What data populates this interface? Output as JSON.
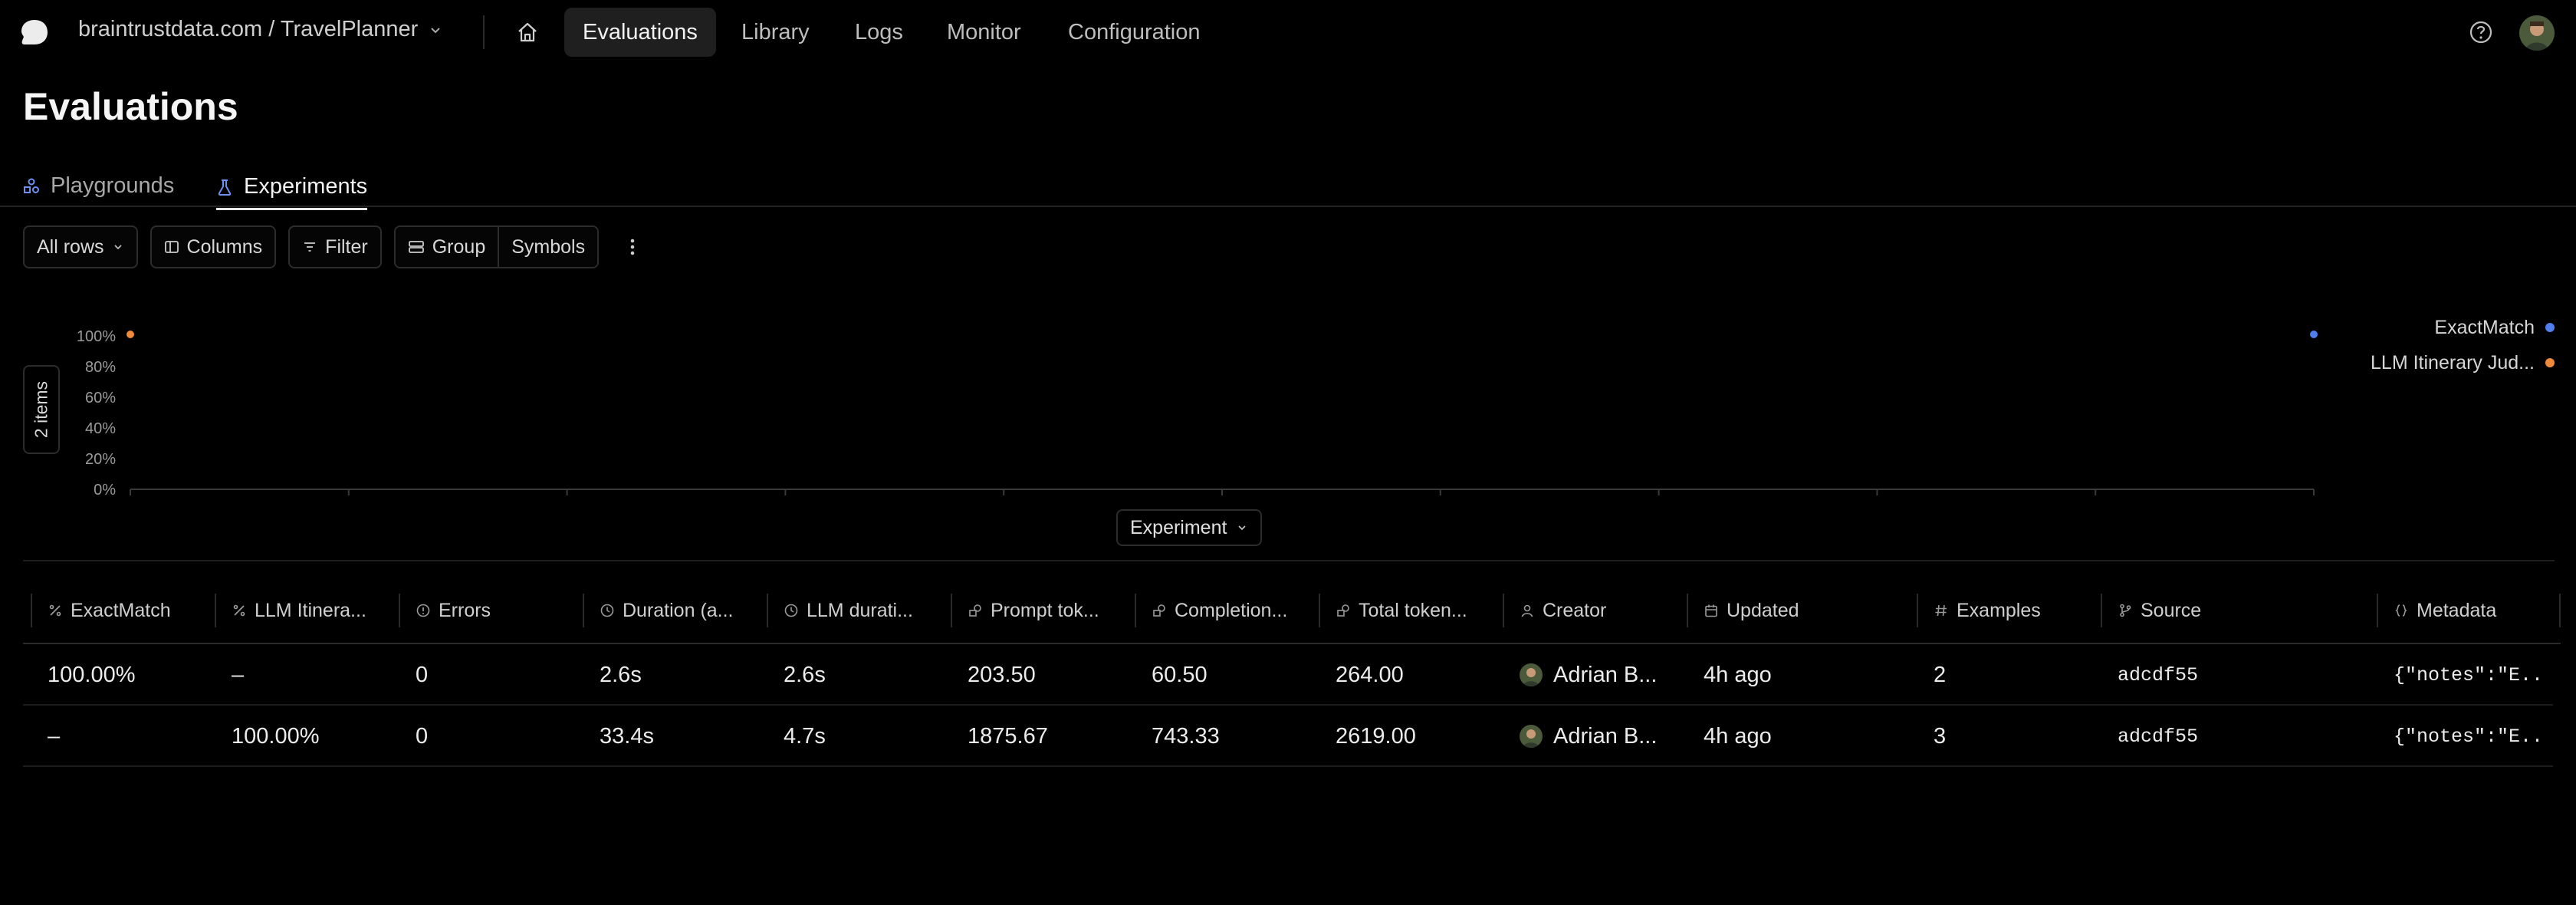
{
  "nav": {
    "org_project": "braintrustdata.com / TravelPlanner",
    "tabs": [
      {
        "label": "Evaluations",
        "active": true
      },
      {
        "label": "Library",
        "active": false
      },
      {
        "label": "Logs",
        "active": false
      },
      {
        "label": "Monitor",
        "active": false
      },
      {
        "label": "Configuration",
        "active": false
      }
    ]
  },
  "page": {
    "title": "Evaluations"
  },
  "subtabs": [
    {
      "label": "Playgrounds",
      "icon": "shapes-icon",
      "active": false
    },
    {
      "label": "Experiments",
      "icon": "flask-icon",
      "active": true
    }
  ],
  "toolbar": {
    "rows_label": "All rows",
    "columns_label": "Columns",
    "filter_label": "Filter",
    "group_label": "Group",
    "symbols_label": "Symbols"
  },
  "chart_panel": {
    "items_label": "2 items",
    "x_selector": "Experiment"
  },
  "chart_data": {
    "type": "scatter",
    "ylim": [
      0,
      100
    ],
    "y_ticks": [
      "0%",
      "20%",
      "40%",
      "60%",
      "80%",
      "100%"
    ],
    "legend_position": "top-right",
    "series": [
      {
        "name": "ExactMatch",
        "color": "#4f7ef0",
        "points": [
          {
            "x": 1,
            "y": 100
          }
        ]
      },
      {
        "name": "LLM Itinerary Jud...",
        "color": "#ee8a3a",
        "points": [
          {
            "x": 0,
            "y": 100
          }
        ]
      }
    ],
    "x_range": [
      0,
      1
    ]
  },
  "table": {
    "columns": [
      {
        "label": "ExactMatch",
        "icon": "percent-icon"
      },
      {
        "label": "LLM Itinera...",
        "icon": "percent-icon"
      },
      {
        "label": "Errors",
        "icon": "alert-circle-icon"
      },
      {
        "label": "Duration (a...",
        "icon": "clock-icon"
      },
      {
        "label": "LLM durati...",
        "icon": "clock-icon"
      },
      {
        "label": "Prompt tok...",
        "icon": "coins-icon"
      },
      {
        "label": "Completion...",
        "icon": "coins-icon"
      },
      {
        "label": "Total token...",
        "icon": "coins-icon"
      },
      {
        "label": "Creator",
        "icon": "user-icon"
      },
      {
        "label": "Updated",
        "icon": "calendar-icon"
      },
      {
        "label": "Examples",
        "icon": "hash-icon"
      },
      {
        "label": "Source",
        "icon": "git-branch-icon"
      },
      {
        "label": "Metadata",
        "icon": "braces-icon"
      }
    ],
    "rows": [
      [
        "100.00%",
        "–",
        "0",
        "2.6s",
        "2.6s",
        "203.50",
        "60.50",
        "264.00",
        "Adrian B...",
        "4h ago",
        "2",
        "adcdf55",
        "{\"notes\":\"E..."
      ],
      [
        "–",
        "100.00%",
        "0",
        "33.4s",
        "4.7s",
        "1875.67",
        "743.33",
        "2619.00",
        "Adrian B...",
        "4h ago",
        "3",
        "adcdf55",
        "{\"notes\":\"E..."
      ]
    ]
  }
}
